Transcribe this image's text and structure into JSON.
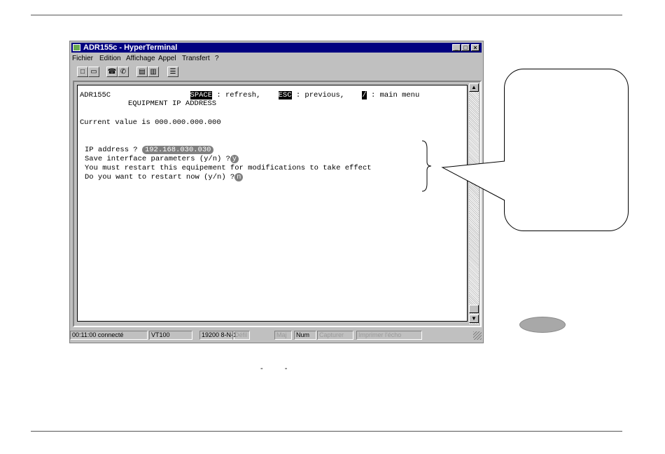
{
  "window": {
    "title": "ADR155c - HyperTerminal",
    "controls": [
      "_",
      "□",
      "×"
    ]
  },
  "menu": [
    "Fichier",
    "Edition",
    "Affichage",
    "Appel",
    "Transfert",
    "?"
  ],
  "toolbar_icons": [
    "new-icon",
    "open-icon",
    "phone-icon",
    "disconnect-icon",
    "send-icon",
    "receive-icon",
    "properties-icon"
  ],
  "terminal": {
    "header_device": "ADR155C",
    "key_space": "SPACE",
    "label_refresh": ": refresh,",
    "key_esc": "ESC",
    "label_previous": ": previous,",
    "key_slash": "/",
    "label_main_menu": ": main menu",
    "screen_title": "EQUIPMENT IP ADDRESS",
    "current_value": "Current value is 000.000.000.000",
    "ip_prompt": "IP address ?",
    "ip_value": "192.168.030.030",
    "save_prompt": "Save interface parameters (y/n) ?",
    "save_answer": "y",
    "restart_notice": "You must restart this equipement for modifications to take effect",
    "restart_prompt": "Do you want to restart now (y/n) ?",
    "restart_answer": "n"
  },
  "statusbar": {
    "connected": "00:11:00 connecté",
    "emulation": "VT100",
    "port_settings": "19200 8-N-1",
    "scroll": "Défil",
    "caps": "Maj",
    "num": "Num",
    "capture": "Capturer",
    "print_echo": "Imprimer l'écho"
  },
  "page": {
    "dashes": "-  -"
  }
}
